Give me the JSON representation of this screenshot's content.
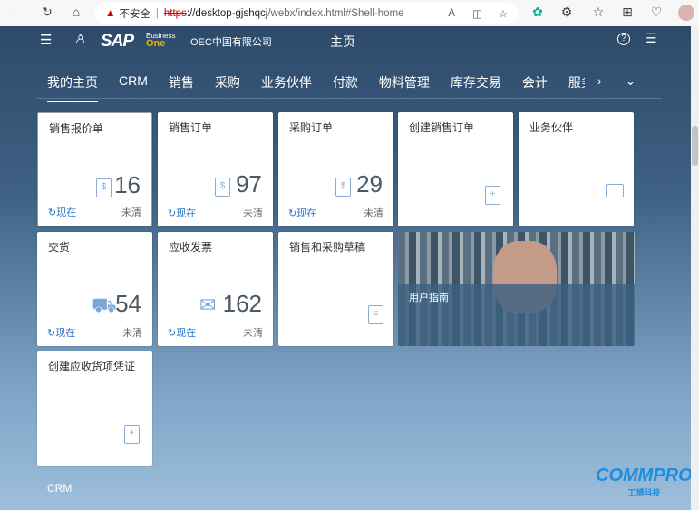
{
  "browser": {
    "security": "不安全",
    "url_scheme": "https",
    "url_host": "://desktop-gjshqcj",
    "url_path": "/webx/index.html#Shell-home"
  },
  "shell": {
    "logo_main": "SAP",
    "logo_sub1": "Business",
    "logo_sub2": "One",
    "company": "OEC中国有限公司",
    "title": "主页"
  },
  "tabs": [
    "我的主页",
    "CRM",
    "销售",
    "采购",
    "业务伙伴",
    "付款",
    "物料管理",
    "库存交易",
    "会计",
    "服务"
  ],
  "tiles": [
    {
      "title": "销售报价单",
      "count": "16",
      "refresh": "现在",
      "status": "未清",
      "icon": "quotation-icon"
    },
    {
      "title": "销售订单",
      "count": "97",
      "refresh": "现在",
      "status": "未清",
      "icon": "sales-order-icon"
    },
    {
      "title": "采购订单",
      "count": "29",
      "refresh": "现在",
      "status": "未清",
      "icon": "purchase-order-icon"
    },
    {
      "title": "创建销售订单",
      "icon": "add-document-icon"
    },
    {
      "title": "业务伙伴",
      "icon": "business-card-icon"
    },
    {
      "title": "交货",
      "count": "54",
      "refresh": "现在",
      "status": "未清",
      "icon": "truck-icon"
    },
    {
      "title": "应收发票",
      "count": "162",
      "refresh": "现在",
      "status": "未清",
      "icon": "invoice-icon"
    },
    {
      "title": "销售和采购草稿",
      "icon": "draft-icon"
    },
    {
      "title": "用户指南"
    },
    {
      "title": "创建应收货项凭证",
      "icon": "add-document-icon"
    }
  ],
  "section": "CRM",
  "watermark": "COMMPRO 工博科技"
}
